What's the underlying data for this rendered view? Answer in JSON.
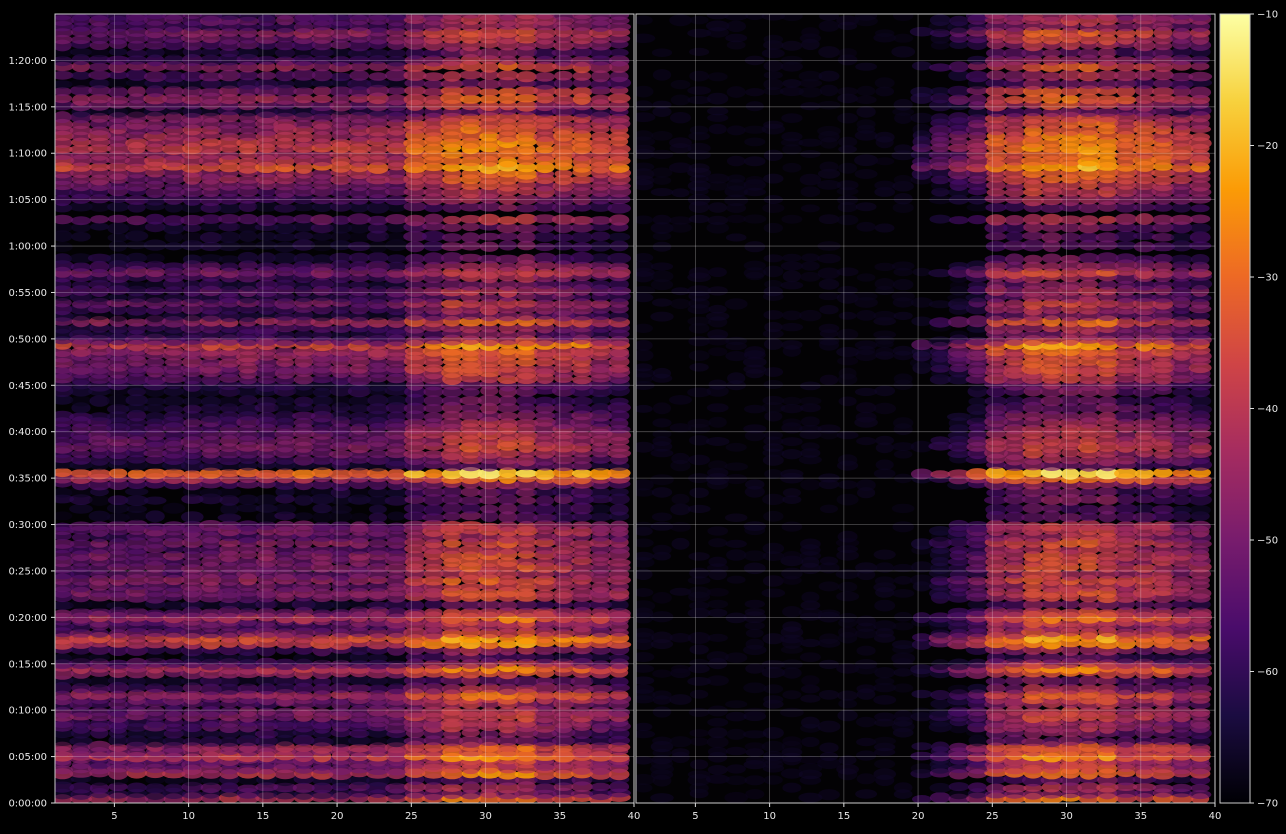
{
  "chart_data": [
    {
      "type": "heatmap",
      "title": "",
      "xlabel": "",
      "ylabel": "",
      "xlim": [
        1,
        40
      ],
      "ylim": [
        0,
        5100
      ],
      "x_ticks": [
        "5",
        "10",
        "15",
        "20",
        "25",
        "30",
        "35",
        "40"
      ],
      "x_tick_values": [
        5,
        10,
        15,
        20,
        25,
        30,
        35,
        40
      ],
      "y_ticks": [
        "0:00:00",
        "0:05:00",
        "0:10:00",
        "0:15:00",
        "0:20:00",
        "0:25:00",
        "0:30:00",
        "0:35:00",
        "0:40:00",
        "0:45:00",
        "0:50:00",
        "0:55:00",
        "1:00:00",
        "1:05:00",
        "1:10:00",
        "1:15:00",
        "1:20:00"
      ],
      "y_tick_values": [
        0,
        300,
        600,
        900,
        1200,
        1500,
        1800,
        2100,
        2400,
        2700,
        3000,
        3300,
        3600,
        3900,
        4200,
        4500,
        4800
      ],
      "grid": true,
      "active_x_range": [
        1,
        40
      ],
      "colormap": "inferno"
    },
    {
      "type": "heatmap",
      "title": "",
      "xlabel": "",
      "ylabel": "",
      "xlim": [
        1,
        40
      ],
      "ylim": [
        0,
        5100
      ],
      "x_ticks": [
        "5",
        "10",
        "15",
        "20",
        "25",
        "30",
        "35",
        "40"
      ],
      "x_tick_values": [
        5,
        10,
        15,
        20,
        25,
        30,
        35,
        40
      ],
      "grid": true,
      "active_x_range": [
        20,
        40
      ],
      "colormap": "inferno"
    }
  ],
  "colorbar": {
    "ticks": [
      "−10",
      "−20",
      "−30",
      "−40",
      "−50",
      "−60",
      "−70"
    ],
    "tick_values": [
      -10,
      -20,
      -30,
      -40,
      -50,
      -60,
      -70
    ],
    "range": [
      -70,
      -10
    ],
    "colors": [
      "#000004",
      "#1b0c41",
      "#4a0c6b",
      "#781c6d",
      "#a52c60",
      "#cf4446",
      "#ed6925",
      "#fb9b06",
      "#f7d13d",
      "#fcffa4"
    ]
  },
  "rows": [
    {
      "t": 30,
      "v": -42
    },
    {
      "t": 60,
      "v": -60
    },
    {
      "t": 100,
      "v": -55
    },
    {
      "t": 150,
      "v": -63
    },
    {
      "t": 190,
      "v": -40
    },
    {
      "t": 220,
      "v": -48
    },
    {
      "t": 250,
      "v": -52
    },
    {
      "t": 280,
      "v": -50
    },
    {
      "t": 300,
      "v": -38
    },
    {
      "t": 330,
      "v": -46
    },
    {
      "t": 360,
      "v": -44
    },
    {
      "t": 400,
      "v": -62
    },
    {
      "t": 450,
      "v": -60
    },
    {
      "t": 490,
      "v": -54
    },
    {
      "t": 520,
      "v": -55
    },
    {
      "t": 560,
      "v": -48
    },
    {
      "t": 590,
      "v": -50
    },
    {
      "t": 640,
      "v": -54
    },
    {
      "t": 670,
      "v": -50
    },
    {
      "t": 700,
      "v": -44
    },
    {
      "t": 740,
      "v": -56
    },
    {
      "t": 790,
      "v": -62
    },
    {
      "t": 840,
      "v": -46
    },
    {
      "t": 870,
      "v": -40
    },
    {
      "t": 900,
      "v": -54
    },
    {
      "t": 940,
      "v": -66
    },
    {
      "t": 990,
      "v": -56
    },
    {
      "t": 1030,
      "v": -38
    },
    {
      "t": 1065,
      "v": -36
    },
    {
      "t": 1100,
      "v": -50
    },
    {
      "t": 1140,
      "v": -54
    },
    {
      "t": 1170,
      "v": -50
    },
    {
      "t": 1200,
      "v": -42
    },
    {
      "t": 1230,
      "v": -50
    },
    {
      "t": 1280,
      "v": -62
    },
    {
      "t": 1330,
      "v": -50
    },
    {
      "t": 1360,
      "v": -48
    },
    {
      "t": 1400,
      "v": -50
    },
    {
      "t": 1440,
      "v": -46
    },
    {
      "t": 1480,
      "v": -52
    },
    {
      "t": 1520,
      "v": -48
    },
    {
      "t": 1560,
      "v": -50
    },
    {
      "t": 1600,
      "v": -48
    },
    {
      "t": 1640,
      "v": -52
    },
    {
      "t": 1680,
      "v": -48
    },
    {
      "t": 1720,
      "v": -54
    },
    {
      "t": 1760,
      "v": -50
    },
    {
      "t": 1790,
      "v": -52
    },
    {
      "t": 1850,
      "v": -64
    },
    {
      "t": 1900,
      "v": -66
    },
    {
      "t": 1960,
      "v": -62
    },
    {
      "t": 2010,
      "v": -64
    },
    {
      "t": 2060,
      "v": -56
    },
    {
      "t": 2095,
      "v": -42
    },
    {
      "t": 2130,
      "v": -30
    },
    {
      "t": 2180,
      "v": -62
    },
    {
      "t": 2220,
      "v": -56
    },
    {
      "t": 2260,
      "v": -52
    },
    {
      "t": 2300,
      "v": -48
    },
    {
      "t": 2340,
      "v": -50
    },
    {
      "t": 2380,
      "v": -52
    },
    {
      "t": 2420,
      "v": -54
    },
    {
      "t": 2460,
      "v": -56
    },
    {
      "t": 2500,
      "v": -58
    },
    {
      "t": 2550,
      "v": -62
    },
    {
      "t": 2600,
      "v": -64
    },
    {
      "t": 2660,
      "v": -62
    },
    {
      "t": 2700,
      "v": -60
    },
    {
      "t": 2740,
      "v": -52
    },
    {
      "t": 2780,
      "v": -50
    },
    {
      "t": 2810,
      "v": -48
    },
    {
      "t": 2850,
      "v": -48
    },
    {
      "t": 2890,
      "v": -46
    },
    {
      "t": 2920,
      "v": -44
    },
    {
      "t": 2960,
      "v": -36
    },
    {
      "t": 2990,
      "v": -52
    },
    {
      "t": 3030,
      "v": -60
    },
    {
      "t": 3070,
      "v": -56
    },
    {
      "t": 3110,
      "v": -44
    },
    {
      "t": 3150,
      "v": -62
    },
    {
      "t": 3190,
      "v": -56
    },
    {
      "t": 3230,
      "v": -50
    },
    {
      "t": 3270,
      "v": -60
    },
    {
      "t": 3310,
      "v": -54
    },
    {
      "t": 3350,
      "v": -60
    },
    {
      "t": 3400,
      "v": -56
    },
    {
      "t": 3430,
      "v": -48
    },
    {
      "t": 3470,
      "v": -56
    },
    {
      "t": 3520,
      "v": -62
    },
    {
      "t": 3600,
      "v": -64
    },
    {
      "t": 3660,
      "v": -64
    },
    {
      "t": 3720,
      "v": -62
    },
    {
      "t": 3770,
      "v": -52
    },
    {
      "t": 3850,
      "v": -62
    },
    {
      "t": 3900,
      "v": -56
    },
    {
      "t": 3950,
      "v": -52
    },
    {
      "t": 3990,
      "v": -50
    },
    {
      "t": 4030,
      "v": -46
    },
    {
      "t": 4070,
      "v": -44
    },
    {
      "t": 4110,
      "v": -34
    },
    {
      "t": 4150,
      "v": -40
    },
    {
      "t": 4190,
      "v": -42
    },
    {
      "t": 4230,
      "v": -38
    },
    {
      "t": 4270,
      "v": -40
    },
    {
      "t": 4310,
      "v": -42
    },
    {
      "t": 4350,
      "v": -44
    },
    {
      "t": 4390,
      "v": -46
    },
    {
      "t": 4430,
      "v": -48
    },
    {
      "t": 4470,
      "v": -62
    },
    {
      "t": 4510,
      "v": -50
    },
    {
      "t": 4550,
      "v": -44
    },
    {
      "t": 4600,
      "v": -48
    },
    {
      "t": 4650,
      "v": -62
    },
    {
      "t": 4700,
      "v": -54
    },
    {
      "t": 4760,
      "v": -46
    },
    {
      "t": 4800,
      "v": -56
    },
    {
      "t": 4850,
      "v": -62
    },
    {
      "t": 4900,
      "v": -54
    },
    {
      "t": 4940,
      "v": -50
    },
    {
      "t": 4980,
      "v": -46
    },
    {
      "t": 5020,
      "v": -56
    },
    {
      "t": 5060,
      "v": -52
    },
    {
      "t": 5090,
      "v": -56
    }
  ]
}
